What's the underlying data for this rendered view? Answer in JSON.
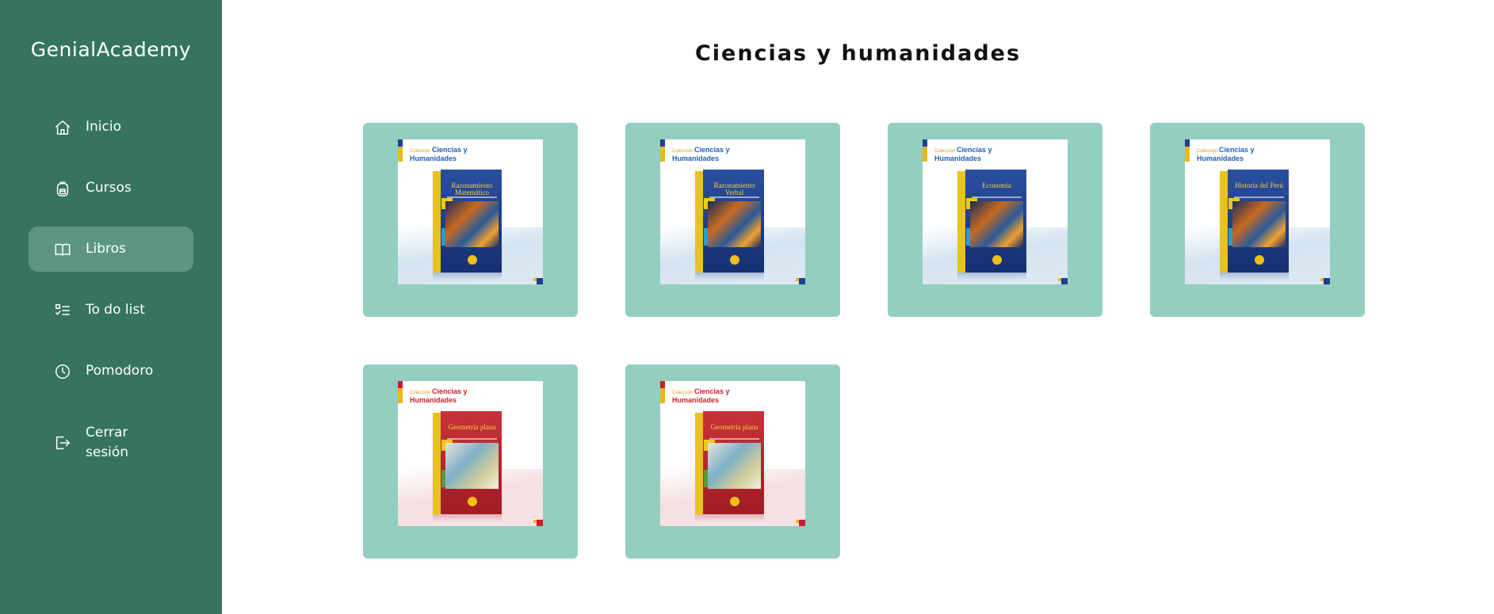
{
  "app": {
    "brand": "GenialAcademy"
  },
  "nav": {
    "items": [
      {
        "key": "inicio",
        "label": "Inicio",
        "icon": "home-icon",
        "active": false
      },
      {
        "key": "cursos",
        "label": "Cursos",
        "icon": "backpack-icon",
        "active": false
      },
      {
        "key": "libros",
        "label": "Libros",
        "icon": "book-icon",
        "active": true
      },
      {
        "key": "todo",
        "label": "To do list",
        "icon": "checklist-icon",
        "active": false
      },
      {
        "key": "pomodoro",
        "label": "Pomodoro",
        "icon": "clock-icon",
        "active": false
      },
      {
        "key": "logout",
        "label": "Cerrar sesión",
        "icon": "logout-icon",
        "active": false
      }
    ]
  },
  "page": {
    "title": "Ciencias y humanidades"
  },
  "books": [
    {
      "title": "Razonamiento Matemático",
      "theme": "blue",
      "series_prefix": "Colección",
      "series": "Ciencias y Humanidades"
    },
    {
      "title": "Razonamiento Verbal",
      "theme": "blue",
      "series_prefix": "Colección",
      "series": "Ciencias y Humanidades"
    },
    {
      "title": "Economía",
      "theme": "blue",
      "series_prefix": "Colección",
      "series": "Ciencias y Humanidades"
    },
    {
      "title": "Historia del Perú",
      "theme": "blue",
      "series_prefix": "Colección",
      "series": "Ciencias y Humanidades"
    },
    {
      "title": "Geometría plana",
      "theme": "red",
      "series_prefix": "Colección",
      "series": "Ciencias y Humanidades"
    },
    {
      "title": "Geometría plana",
      "theme": "red",
      "series_prefix": "Colección",
      "series": "Ciencias y Humanidades"
    }
  ],
  "colors": {
    "sidebar": "#36745f",
    "active_item": "#5d9584",
    "card_bg": "#93cec0",
    "blue_box": "#1c3f8c",
    "red_box": "#b7262c"
  }
}
